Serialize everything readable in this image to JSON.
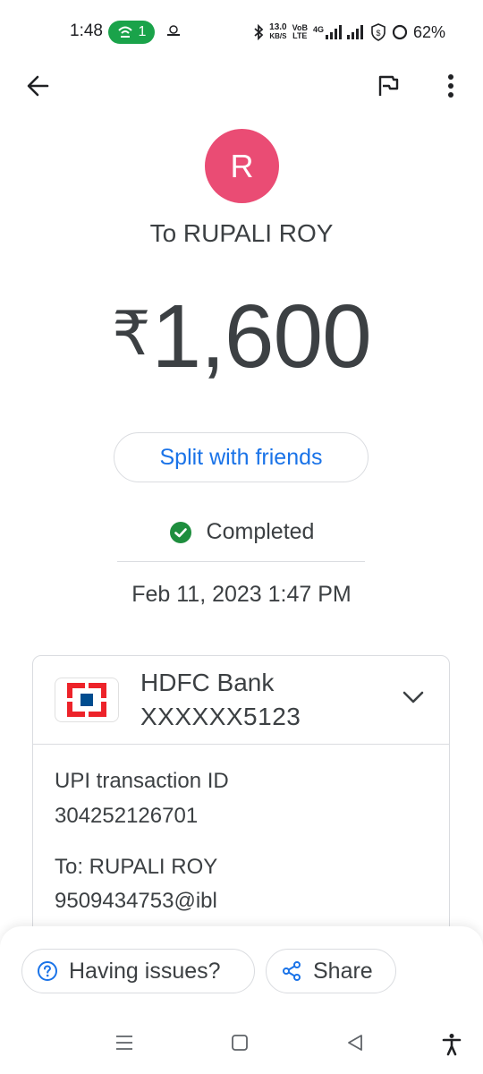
{
  "status_bar": {
    "time": "1:48",
    "hotspot_count": "1",
    "speed_value": "13.0",
    "speed_unit": "KB/S",
    "volte_top": "VoB",
    "volte_bottom": "LTE",
    "network": "4G",
    "battery": "62%"
  },
  "payment": {
    "avatar_letter": "R",
    "avatar_color": "#ea4c74",
    "recipient_line": "To RUPALI ROY",
    "currency_symbol": "₹",
    "amount": "1,600",
    "split_label": "Split with friends",
    "status": "Completed",
    "datetime": "Feb 11, 2023 1:47 PM"
  },
  "card": {
    "bank_name": "HDFC Bank",
    "account": "XXXXXX5123",
    "txn_label": "UPI transaction ID",
    "txn_id": "304252126701",
    "to_label": "To: RUPALI ROY",
    "to_upi": "9509434753@ibl"
  },
  "actions": {
    "issues_label": "Having issues?",
    "share_label": "Share"
  },
  "colors": {
    "accent": "#1a73e8",
    "success": "#1e8e3e",
    "hotspot": "#1aa34a"
  }
}
